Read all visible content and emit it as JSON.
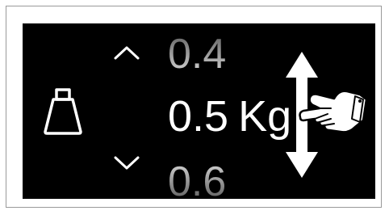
{
  "picker": {
    "previous_value": "0.4",
    "current_value": "0.5",
    "current_unit": "Kg",
    "next_value": "0.6"
  },
  "icons": {
    "weight": "weight-icon",
    "increase": "chevron-up-icon",
    "decrease": "chevron-down-icon",
    "swipe": "vertical-double-arrow-icon",
    "gesture": "pointing-hand-icon"
  },
  "colors": {
    "screen_background": "#000000",
    "foreground": "#ffffff",
    "fade": "#808080"
  }
}
